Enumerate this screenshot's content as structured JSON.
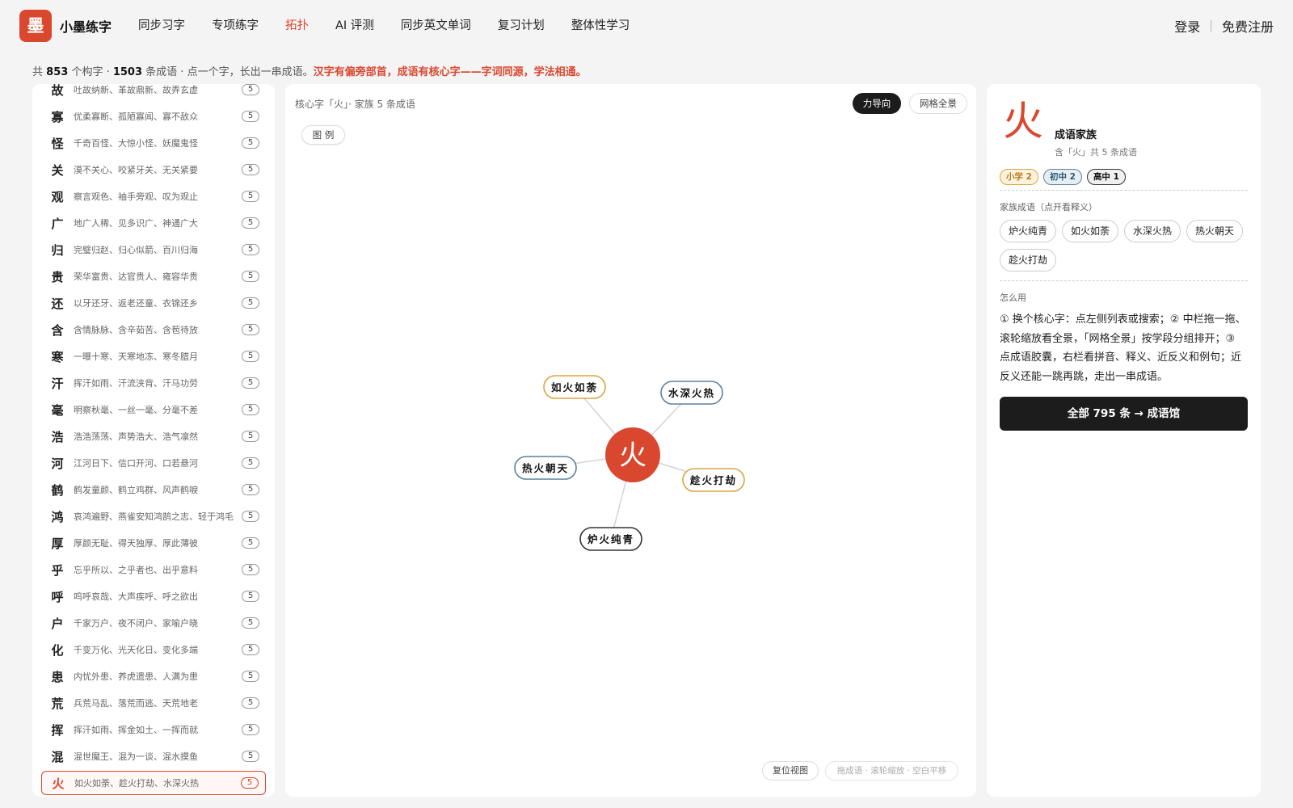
{
  "header": {
    "logo_char": "墨",
    "brand": "小墨练字",
    "nav": [
      "同步习字",
      "专项练字",
      "拓扑",
      "AI 评测",
      "同步英文单词",
      "复习计划",
      "整体性学习"
    ],
    "active_nav": "拓扑",
    "login": "登录",
    "separator": "|",
    "register": "免费注册"
  },
  "stats": {
    "prefix": "共",
    "char_count": "853",
    "char_unit": "个构字 ·",
    "idiom_count": "1503",
    "idiom_unit": "条成语 · 点一个字，长出一串成语。",
    "highlight": "汉字有偏旁部首，成语有核心字——字词同源，学法相通。"
  },
  "char_list": [
    {
      "char": "故",
      "examples": "吐故纳新、革故鼎新、故弄玄虚",
      "count": "5"
    },
    {
      "char": "寡",
      "examples": "优柔寡断、孤陋寡闻、寡不敌众",
      "count": "5"
    },
    {
      "char": "怪",
      "examples": "千奇百怪、大惊小怪、妖魔鬼怪",
      "count": "5"
    },
    {
      "char": "关",
      "examples": "漠不关心、咬紧牙关、无关紧要",
      "count": "5"
    },
    {
      "char": "观",
      "examples": "察言观色、袖手旁观、叹为观止",
      "count": "5"
    },
    {
      "char": "广",
      "examples": "地广人稀、见多识广、神通广大",
      "count": "5"
    },
    {
      "char": "归",
      "examples": "完璧归赵、归心似箭、百川归海",
      "count": "5"
    },
    {
      "char": "贵",
      "examples": "荣华富贵、达官贵人、雍容华贵",
      "count": "5"
    },
    {
      "char": "还",
      "examples": "以牙还牙、返老还童、衣锦还乡",
      "count": "5"
    },
    {
      "char": "含",
      "examples": "含情脉脉、含辛茹苦、含苞待放",
      "count": "5"
    },
    {
      "char": "寒",
      "examples": "一曝十寒、天寒地冻、寒冬腊月",
      "count": "5"
    },
    {
      "char": "汗",
      "examples": "挥汗如雨、汗流浃背、汗马功劳",
      "count": "5"
    },
    {
      "char": "毫",
      "examples": "明察秋毫、一丝一毫、分毫不差",
      "count": "5"
    },
    {
      "char": "浩",
      "examples": "浩浩荡荡、声势浩大、浩气凛然",
      "count": "5"
    },
    {
      "char": "河",
      "examples": "江河日下、信口开河、口若悬河",
      "count": "5"
    },
    {
      "char": "鹤",
      "examples": "鹤发童颜、鹤立鸡群、风声鹤唳",
      "count": "5"
    },
    {
      "char": "鸿",
      "examples": "哀鸿遍野、燕雀安知鸿鹄之志、轻于鸿毛",
      "count": "5"
    },
    {
      "char": "厚",
      "examples": "厚颜无耻、得天独厚、厚此薄彼",
      "count": "5"
    },
    {
      "char": "乎",
      "examples": "忘乎所以、之乎者也、出乎意料",
      "count": "5"
    },
    {
      "char": "呼",
      "examples": "呜呼哀哉、大声疾呼、呼之欲出",
      "count": "5"
    },
    {
      "char": "户",
      "examples": "千家万户、夜不闭户、家喻户晓",
      "count": "5"
    },
    {
      "char": "化",
      "examples": "千变万化、光天化日、变化多端",
      "count": "5"
    },
    {
      "char": "患",
      "examples": "内忧外患、养虎遗患、人满为患",
      "count": "5"
    },
    {
      "char": "荒",
      "examples": "兵荒马乱、落荒而逃、天荒地老",
      "count": "5"
    },
    {
      "char": "挥",
      "examples": "挥汗如雨、挥金如土、一挥而就",
      "count": "5"
    },
    {
      "char": "混",
      "examples": "混世魔王、混为一谈、混水摸鱼",
      "count": "5"
    },
    {
      "char": "火",
      "examples": "如火如荼、趁火打劫、水深火热",
      "count": "5",
      "active": true
    }
  ],
  "graph": {
    "title": "核心字「火」· 家族 5 条成语",
    "btn_force": "力导向",
    "btn_grid": "网格全景",
    "legend": "图 例",
    "center_char": "火",
    "nodes": [
      {
        "label": "如火如荼",
        "level": "primary"
      },
      {
        "label": "水深火热",
        "level": "junior"
      },
      {
        "label": "热火朝天",
        "level": "junior"
      },
      {
        "label": "趁火打劫",
        "level": "primary"
      },
      {
        "label": "炉火纯青",
        "level": "senior"
      }
    ],
    "reset": "复位视图",
    "hint": "拖成语 · 滚轮缩放 · 空白平移"
  },
  "colors": {
    "accent": "#d9472e",
    "primary": "#d9a441",
    "junior": "#5a829e",
    "senior": "#333333"
  },
  "panel": {
    "big_char": "火",
    "title": "成语家族",
    "subtitle": "含「火」共 5 条成语",
    "badges": [
      "小学 2",
      "初中 2",
      "高中 1"
    ],
    "family_label": "家族成语（点开看释义）",
    "family": [
      "炉火纯青",
      "如火如荼",
      "水深火热",
      "热火朝天",
      "趁火打劫"
    ],
    "howto_label": "怎么用",
    "howto": "① 换个核心字：点左侧列表或搜索；② 中栏拖一拖、滚轮缩放看全景，「网格全景」按学段分组排开；③ 点成语胶囊，右栏看拼音、释义、近反义和例句；近反义还能一跳再跳，走出一串成语。",
    "cta": "全部 795 条 → 成语馆"
  }
}
